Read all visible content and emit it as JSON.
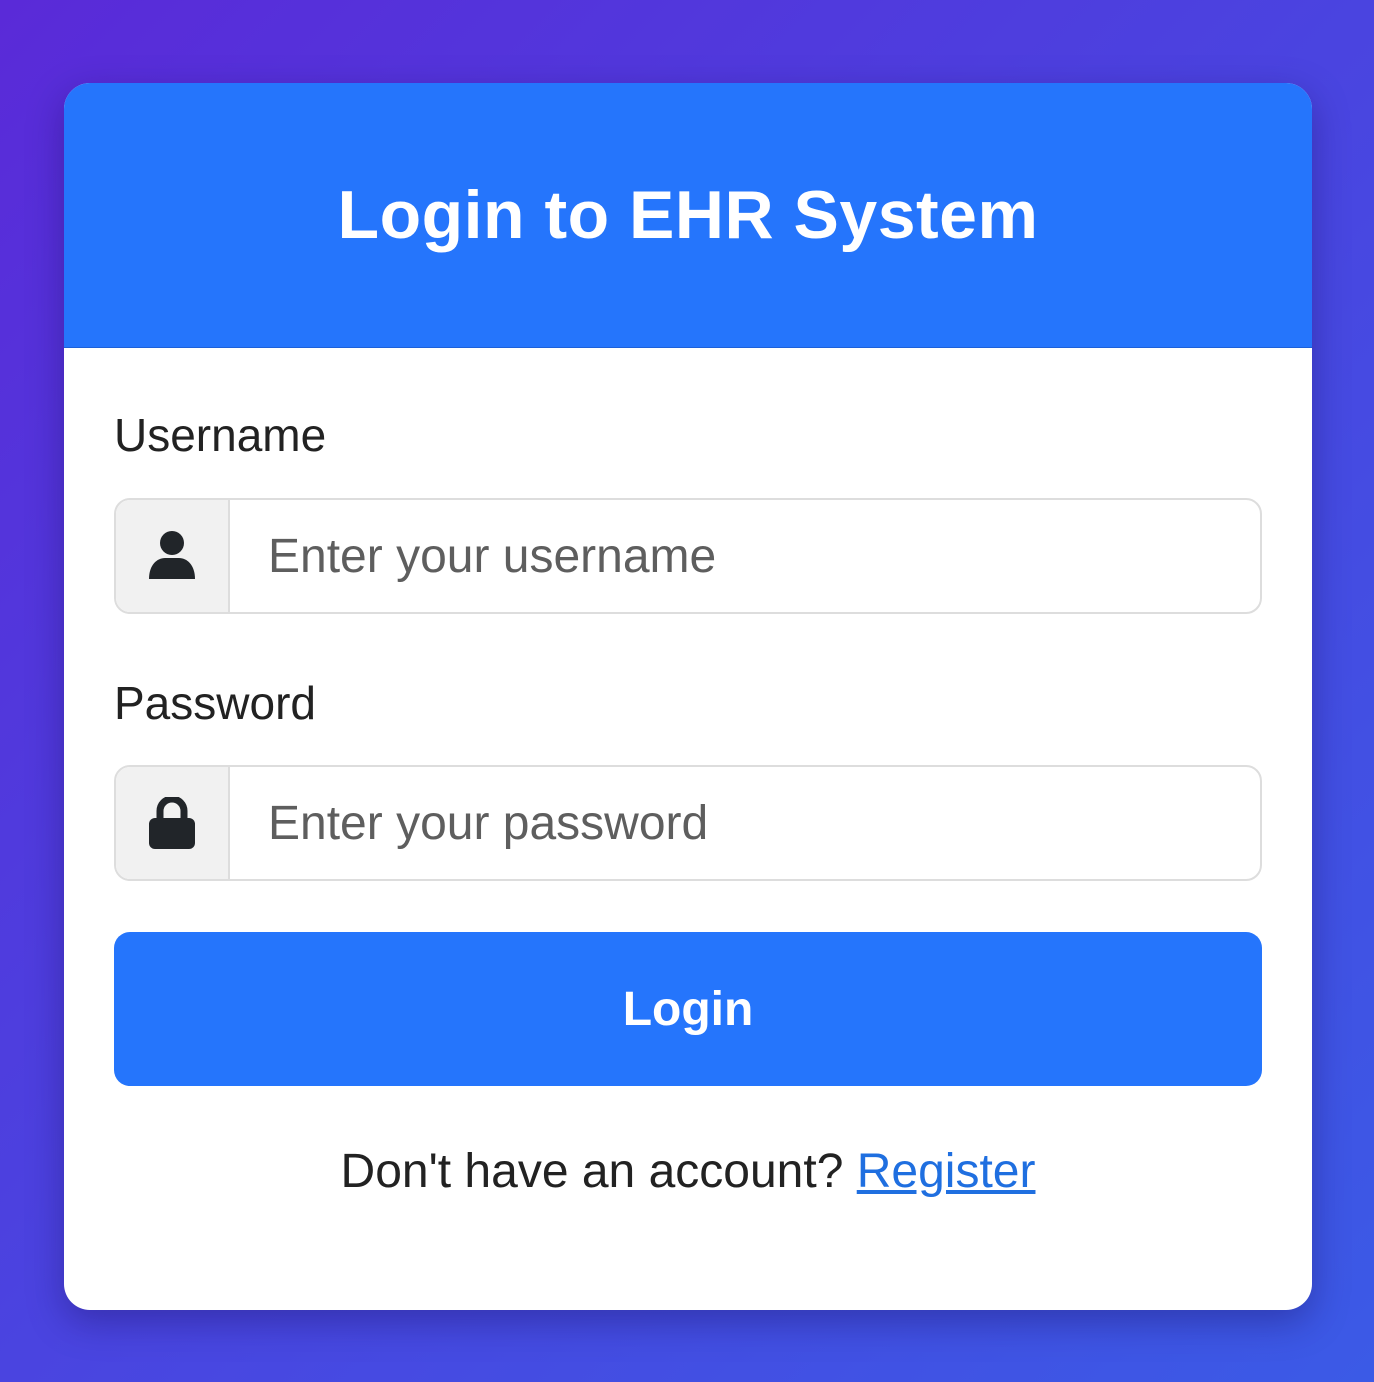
{
  "header": {
    "title": "Login to EHR System"
  },
  "form": {
    "username": {
      "label": "Username",
      "placeholder": "Enter your username",
      "value": "",
      "icon": "user-icon"
    },
    "password": {
      "label": "Password",
      "placeholder": "Enter your password",
      "value": "",
      "icon": "lock-icon"
    },
    "submit_label": "Login"
  },
  "footer": {
    "prompt": "Don't have an account?",
    "link_label": "Register"
  },
  "colors": {
    "primary": "#2575fc",
    "background_start": "#5a2ad8",
    "background_end": "#3b5ae6",
    "link": "#1f6fe0"
  }
}
